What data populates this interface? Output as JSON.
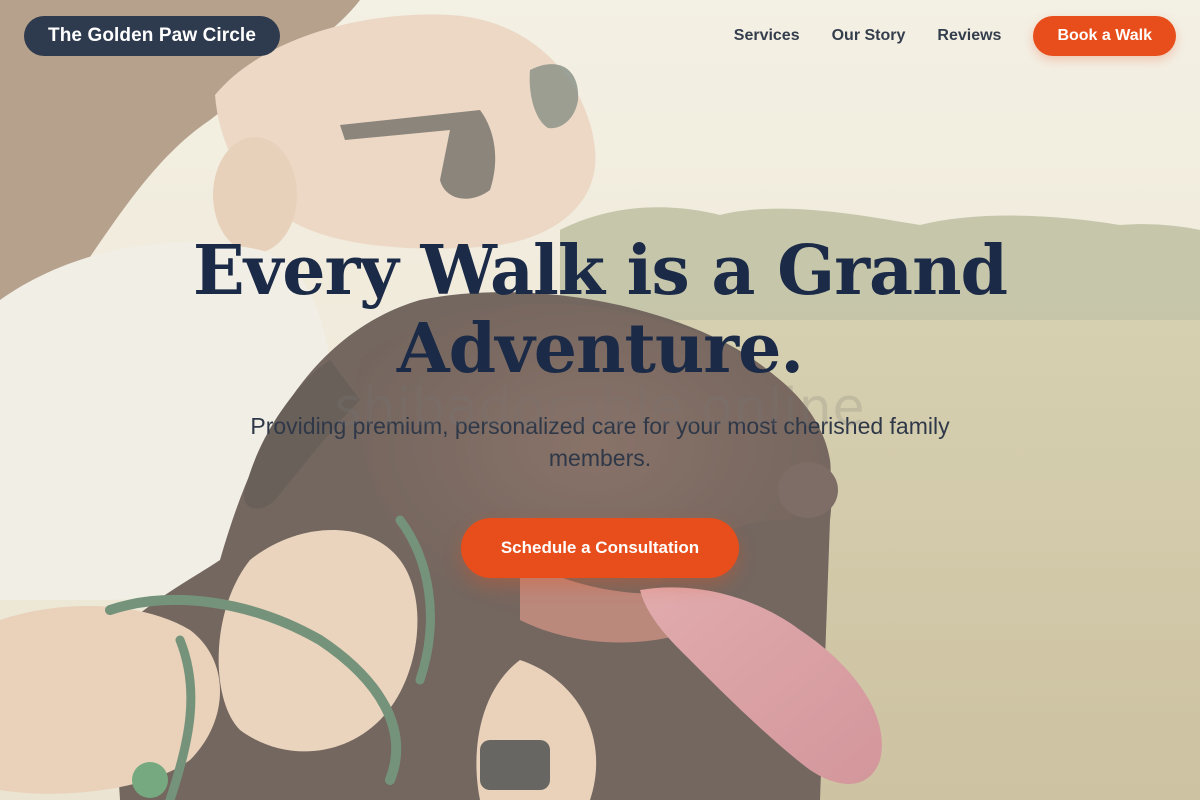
{
  "brand": {
    "name": "The Golden Paw Circle"
  },
  "nav": {
    "links": [
      {
        "label": "Services"
      },
      {
        "label": "Our Story"
      },
      {
        "label": "Reviews"
      }
    ],
    "cta_label": "Book a Walk"
  },
  "hero": {
    "headline": "Every Walk is a Grand Adventure.",
    "subtitle": "Providing premium, personalized care for your most cherished family members.",
    "cta_label": "Schedule a Consultation",
    "watermark": "shibadorable.online"
  },
  "colors": {
    "accent": "#e84e1b",
    "brand_bg": "#2e3a4e",
    "headline": "#1b2a47"
  }
}
